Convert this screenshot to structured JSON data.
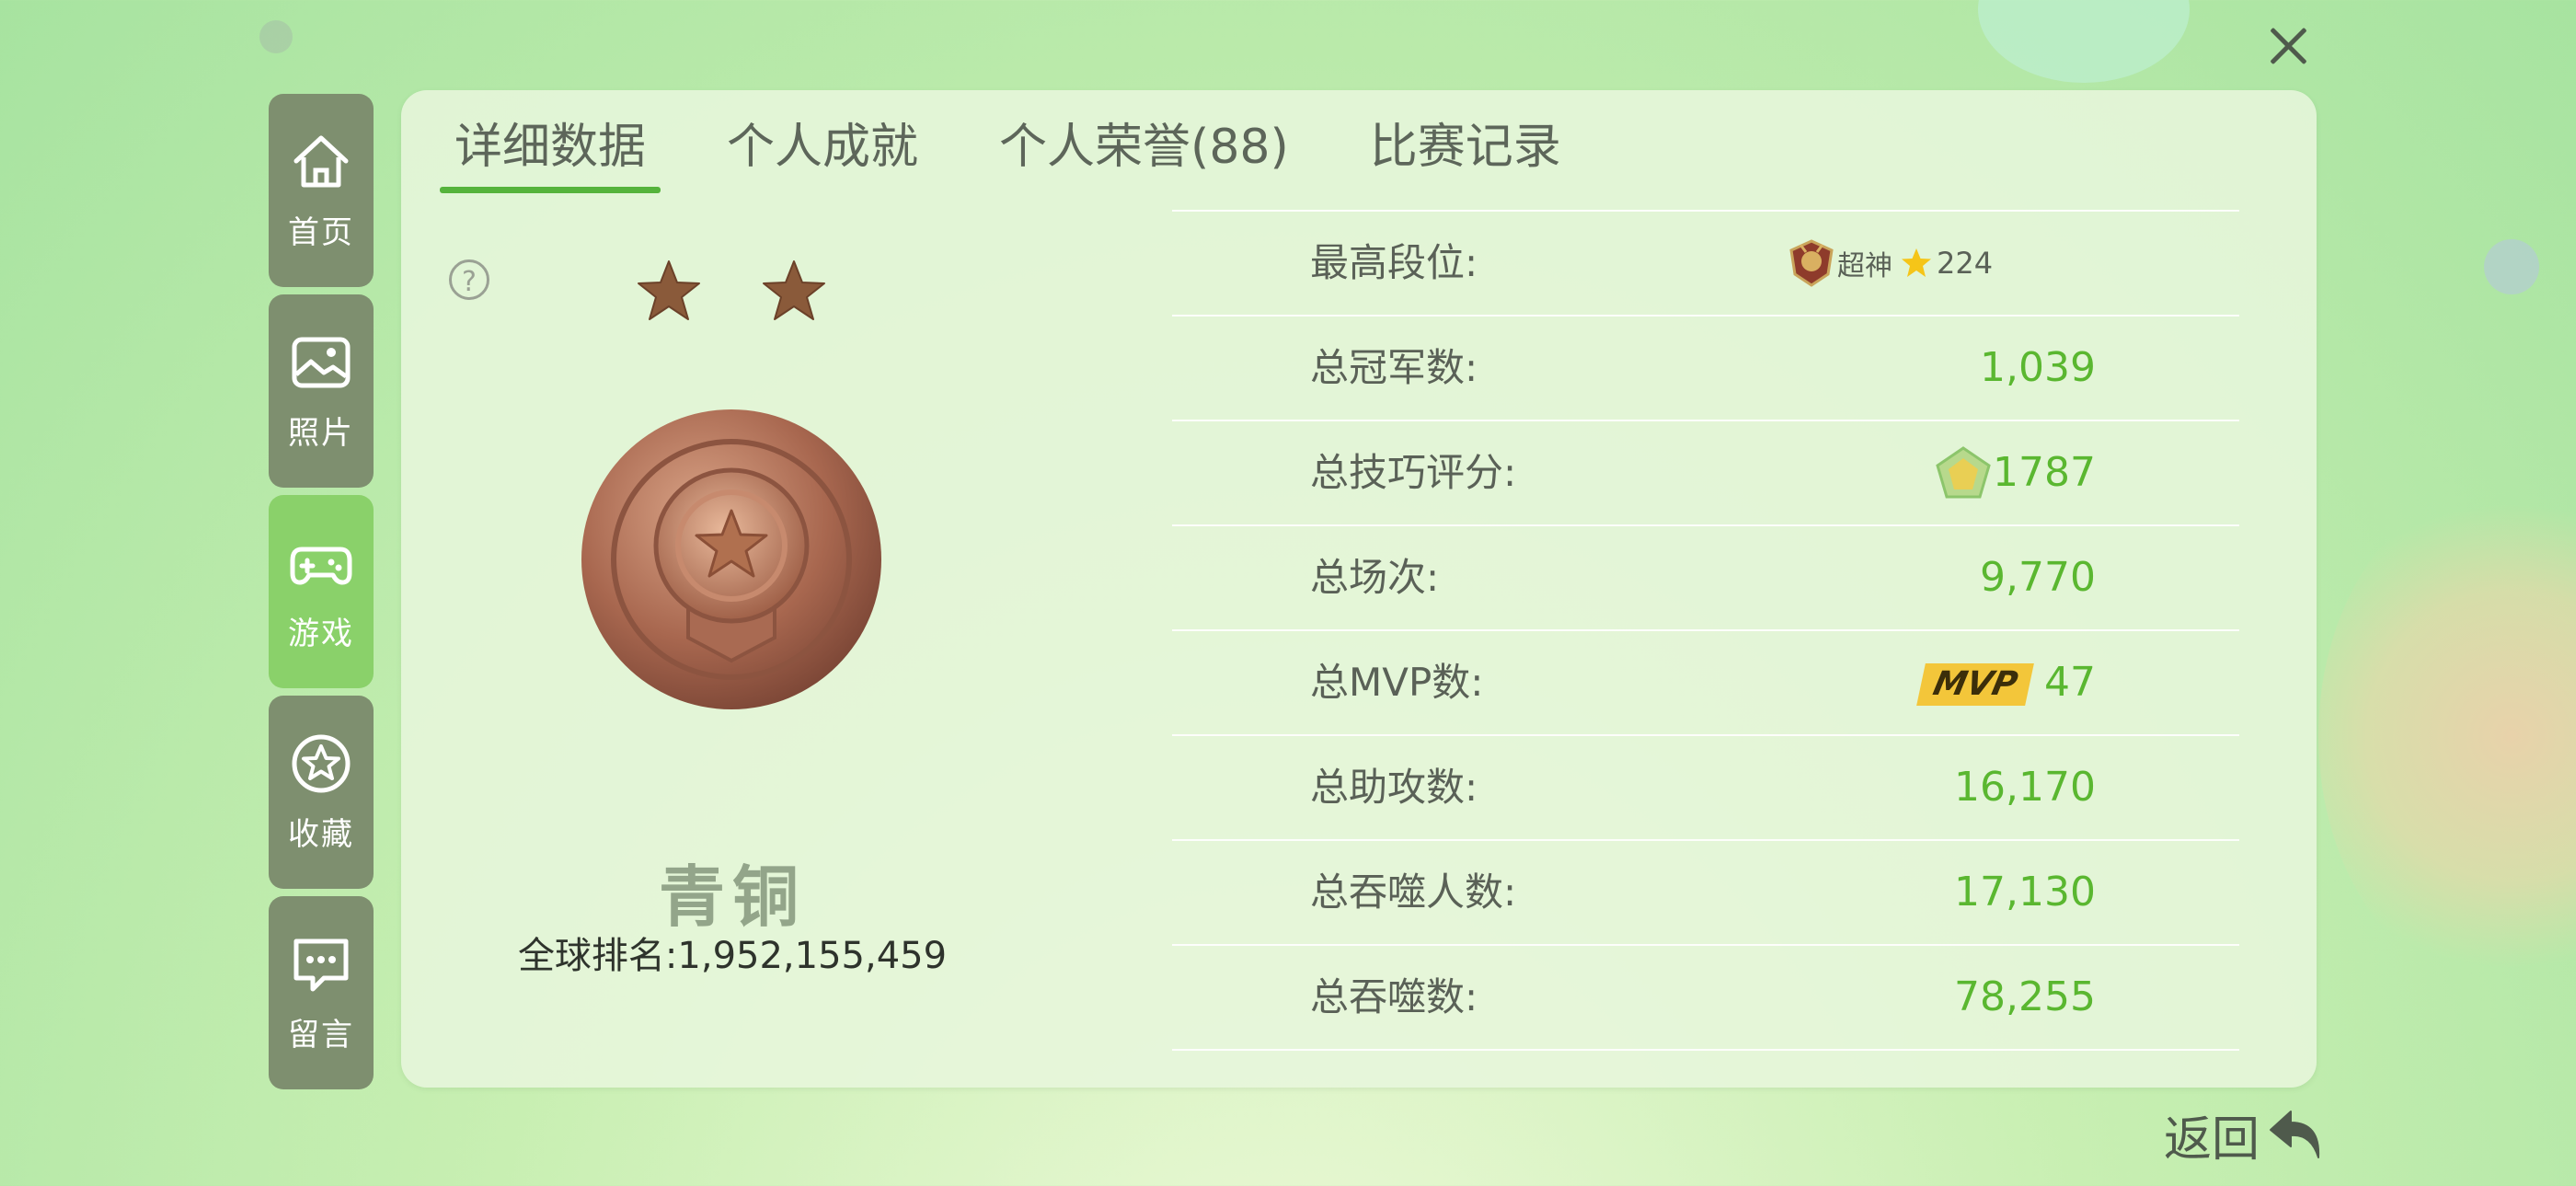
{
  "nav": {
    "items": [
      {
        "label": "首页",
        "icon": "home-icon"
      },
      {
        "label": "照片",
        "icon": "photo-icon"
      },
      {
        "label": "游戏",
        "icon": "gamepad-icon"
      },
      {
        "label": "收藏",
        "icon": "star-icon"
      },
      {
        "label": "留言",
        "icon": "message-icon"
      }
    ],
    "active_index": 2
  },
  "tabs": [
    "详细数据",
    "个人成就",
    "个人荣誉(88)",
    "比赛记录"
  ],
  "active_tab": 0,
  "rank": {
    "name": "青铜",
    "stars": 2,
    "global_label": "全球排名:1,952,155,459"
  },
  "stats": {
    "peak": {
      "label": "最高段位:",
      "tier": "超神",
      "stars": "224"
    },
    "rows": [
      {
        "label": "总冠军数:",
        "value": "1,039"
      },
      {
        "label": "总技巧评分:",
        "value": "1787"
      },
      {
        "label": "总场次:",
        "value": "9,770"
      },
      {
        "label": "总MVP数:",
        "value": "47",
        "badge": "MVP"
      },
      {
        "label": "总助攻数:",
        "value": "16,170"
      },
      {
        "label": "总吞噬人数:",
        "value": "17,130"
      },
      {
        "label": "总吞噬数:",
        "value": "78,255"
      }
    ]
  },
  "back_label": "返回",
  "colors": {
    "accent": "#55b33c",
    "value": "#5ab730",
    "nav": "#7e8f6f",
    "nav_active": "#8ad16a",
    "bronze": "#a8674f"
  }
}
